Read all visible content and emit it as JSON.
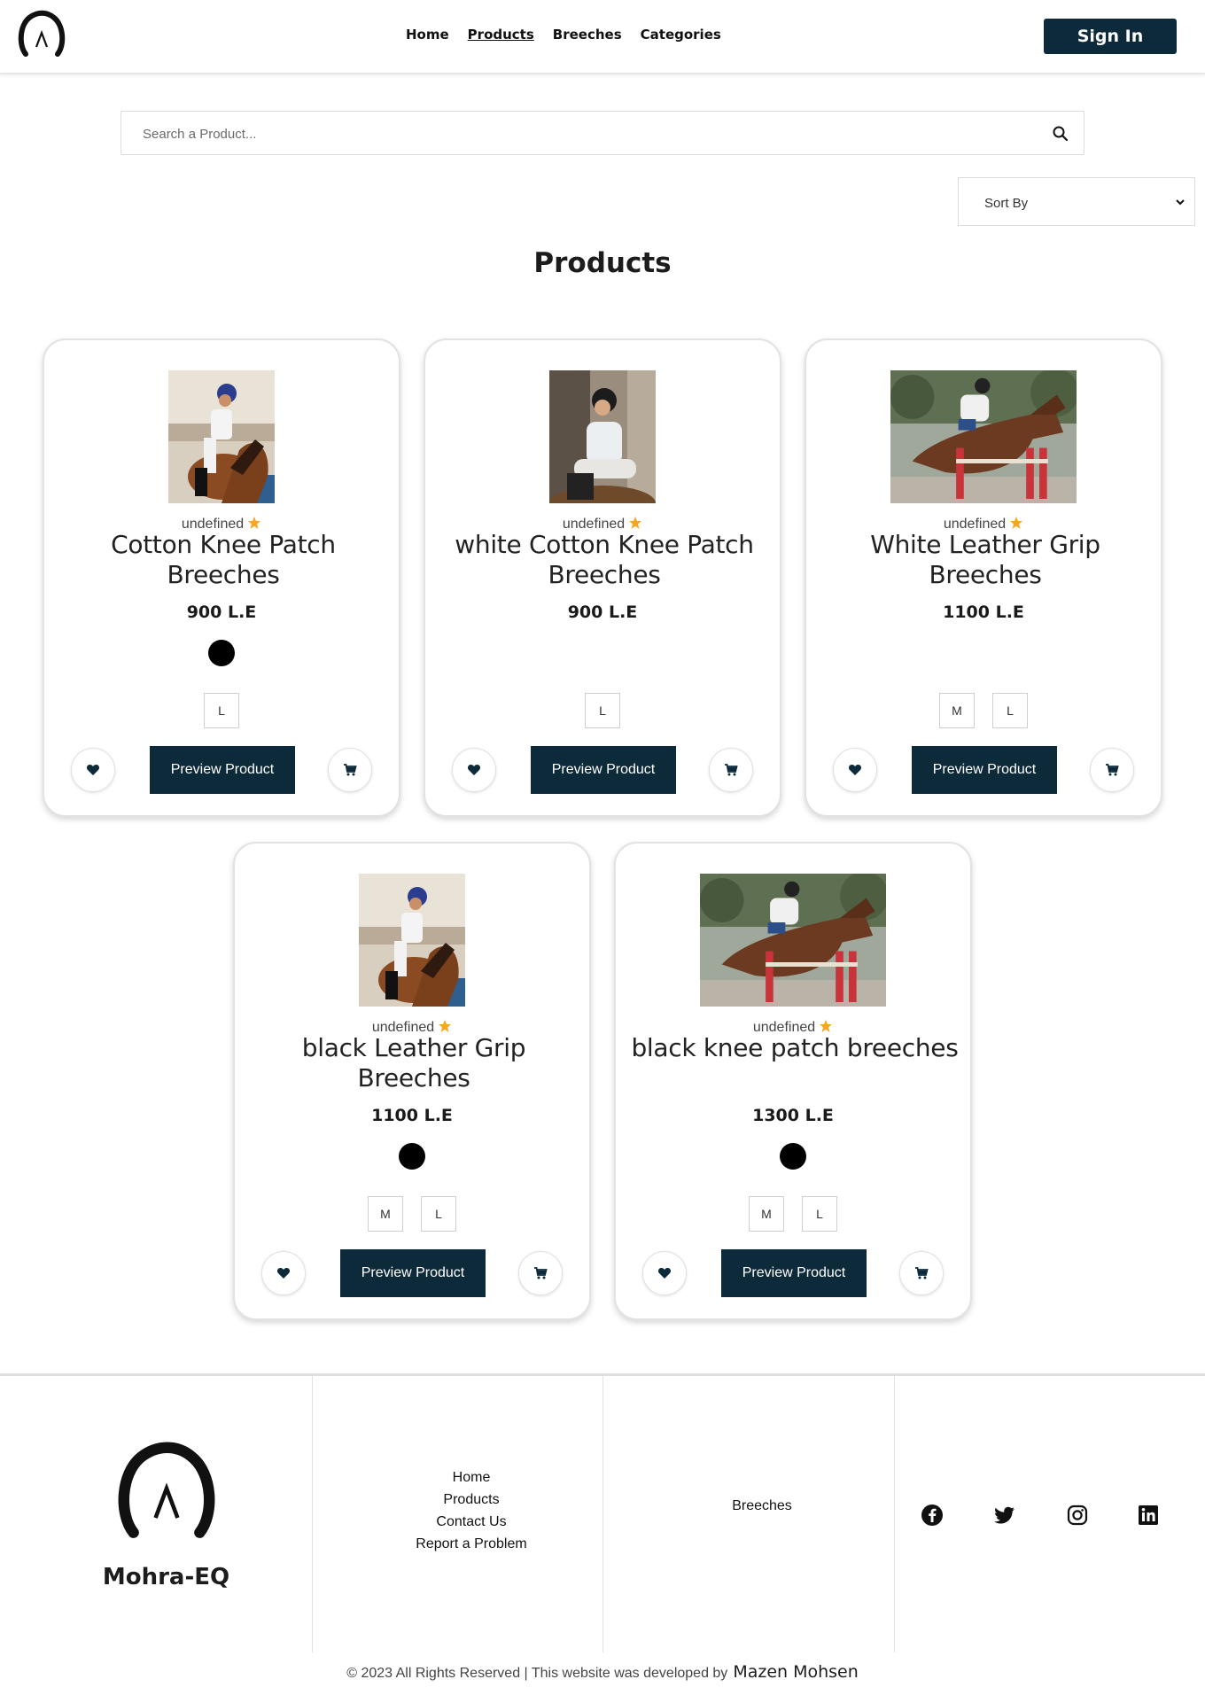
{
  "header": {
    "nav": [
      {
        "label": "Home",
        "active": false
      },
      {
        "label": "Products",
        "active": true
      },
      {
        "label": "Breeches",
        "active": false
      },
      {
        "label": "Categories",
        "active": false
      }
    ],
    "sign_in_label": "Sign In"
  },
  "search": {
    "placeholder": "Search a Product..."
  },
  "sort": {
    "label": "Sort By"
  },
  "page_title": "Products",
  "products": [
    {
      "rating": "undefined",
      "name": "Cotton Knee Patch Breeches",
      "price": "900 L.E",
      "colors": [
        "#000000"
      ],
      "sizes": [
        "L"
      ],
      "preview_label": "Preview Product",
      "image": "rider-blue-helmet"
    },
    {
      "rating": "undefined",
      "name": "white Cotton Knee Patch Breeches",
      "price": "900 L.E",
      "colors": [],
      "sizes": [
        "L"
      ],
      "preview_label": "Preview Product",
      "image": "rider-seated-portrait"
    },
    {
      "rating": "undefined",
      "name": "White Leather Grip Breeches",
      "price": "1100 L.E",
      "colors": [],
      "sizes": [
        "M",
        "L"
      ],
      "preview_label": "Preview Product",
      "image": "horse-jumping"
    },
    {
      "rating": "undefined",
      "name": "black Leather Grip Breeches",
      "price": "1100 L.E",
      "colors": [
        "#000000"
      ],
      "sizes": [
        "M",
        "L"
      ],
      "preview_label": "Preview Product",
      "image": "rider-blue-helmet"
    },
    {
      "rating": "undefined",
      "name": "black knee patch breeches",
      "price": "1300 L.E",
      "colors": [
        "#000000"
      ],
      "sizes": [
        "M",
        "L"
      ],
      "preview_label": "Preview Product",
      "image": "horse-jumping"
    }
  ],
  "footer": {
    "brand": "Mohra-EQ",
    "links": [
      "Home",
      "Products",
      "Contact Us",
      "Report a Problem"
    ],
    "categories": [
      "Breeches"
    ],
    "social": [
      "facebook-icon",
      "twitter-icon",
      "instagram-icon",
      "linkedin-icon"
    ],
    "copyright": "© 2023 All Rights Reserved | This website was developed by",
    "developer": "Mazen Mohsen"
  },
  "colors": {
    "primary": "#0d2a3a",
    "star": "#f5a623"
  }
}
